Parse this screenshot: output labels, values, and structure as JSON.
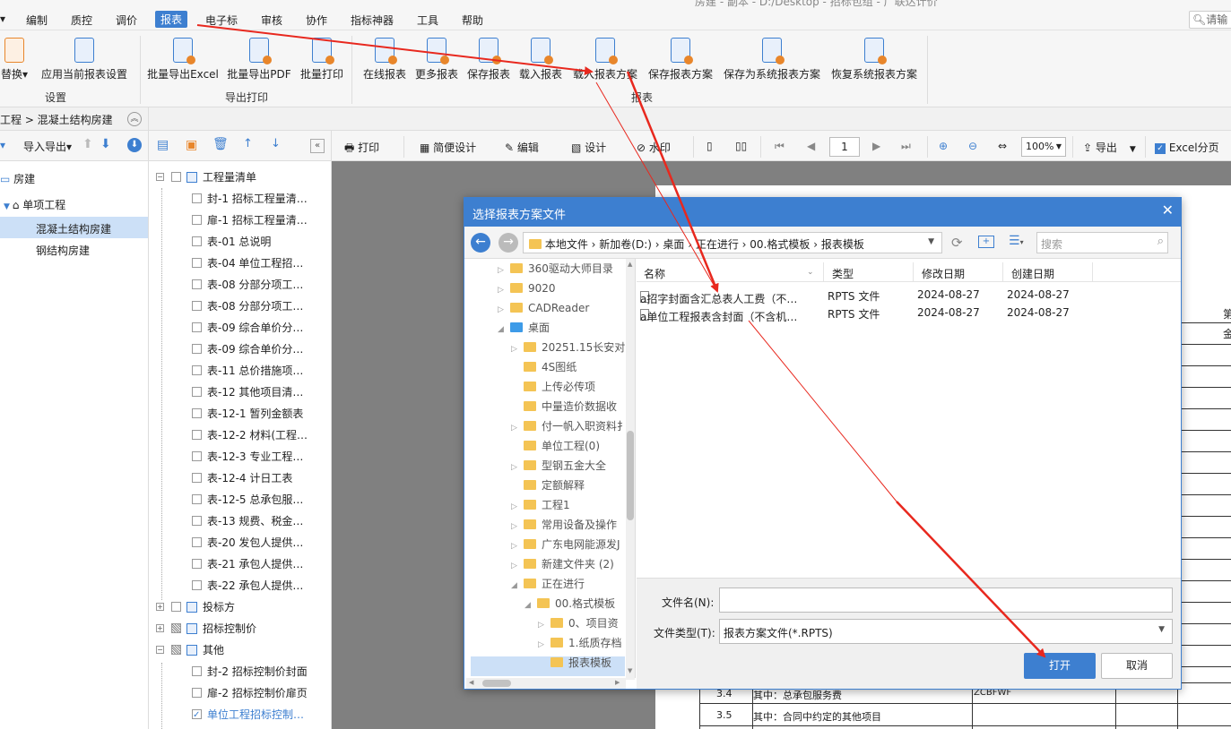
{
  "titlebar": {
    "text": "房建 - 副本 - D:/Desktop - 招标包组 - 广联达计价"
  },
  "menu": {
    "items": [
      "编制",
      "质控",
      "调价",
      "报表",
      "电子标",
      "审核",
      "协作",
      "指标神器",
      "工具",
      "帮助"
    ],
    "active": "报表",
    "search_placeholder": "请输"
  },
  "ribbon": {
    "settings": {
      "items": [
        "替换",
        "应用当前报表设置"
      ],
      "label": "设置"
    },
    "export_print": {
      "items": [
        "批量导出Excel",
        "批量导出PDF",
        "批量打印"
      ],
      "label": "导出打印"
    },
    "report": {
      "items": [
        "在线报表",
        "更多报表",
        "保存报表",
        "载入报表",
        "载入报表方案",
        "保存报表方案",
        "保存为系统报表方案",
        "恢复系统报表方案"
      ],
      "label": "报表"
    }
  },
  "breadcrumb": {
    "text": "工程 > 混凝土结构房建"
  },
  "left": {
    "toolbar": {
      "import_export": "导入导出"
    },
    "tree": [
      {
        "label": "房建",
        "level": 0
      },
      {
        "label": "单项工程",
        "level": 1
      },
      {
        "label": "混凝土结构房建",
        "level": 2,
        "selected": true
      },
      {
        "label": "钢结构房建",
        "level": 2
      }
    ]
  },
  "reports": {
    "groups": [
      {
        "label": "工程量清单",
        "expanded": true,
        "items": [
          "封-1 招标工程量清…",
          "扉-1 招标工程量清…",
          "表-01 总说明",
          "表-04 单位工程招…",
          "表-08 分部分项工…",
          "表-08 分部分项工…",
          "表-09 综合单价分…",
          "表-09 综合单价分…",
          "表-11 总价措施项…",
          "表-12 其他项目清…",
          "表-12-1 暂列金额表",
          "表-12-2 材料(工程…",
          "表-12-3 专业工程…",
          "表-12-4 计日工表",
          "表-12-5 总承包服…",
          "表-13 规费、税金…",
          "表-20 发包人提供…",
          "表-21 承包人提供…",
          "表-22 承包人提供…"
        ]
      },
      {
        "label": "投标方",
        "expanded": false,
        "items": []
      },
      {
        "label": "招标控制价",
        "expanded": false,
        "items": []
      },
      {
        "label": "其他",
        "expanded": true,
        "items": [
          "封-2 招标控制价封面",
          "扉-2 招标控制价扉页",
          "单位工程招标控制…"
        ]
      }
    ],
    "checked_item": "单位工程招标控制…"
  },
  "preview_toolbar": {
    "print": "打印",
    "simple_design": "简便设计",
    "edit": "编辑",
    "design": "设计",
    "watermark": "水印",
    "page": "1",
    "zoom": "100%",
    "export": "导出",
    "excel_paging": "Excel分页"
  },
  "preview": {
    "rows": [
      {
        "no": "3.4",
        "name": "其中：总承包服务费",
        "code": "ZCBFWF"
      },
      {
        "no": "3.5",
        "name": "其中：合同中约定的其他项目",
        "code": ""
      }
    ],
    "edge_text": [
      "第",
      "金"
    ]
  },
  "dialog": {
    "title": "选择报表方案文件",
    "path": [
      "本地文件",
      "新加卷(D:)",
      "桌面",
      "正在进行",
      "00.格式模板",
      "报表模板"
    ],
    "search_placeholder": "搜索",
    "folders": [
      {
        "label": "360驱动大师目录",
        "level": 1,
        "arrow": true
      },
      {
        "label": "9020",
        "level": 1,
        "arrow": true
      },
      {
        "label": "CADReader",
        "level": 1,
        "arrow": true
      },
      {
        "label": "桌面",
        "level": 1,
        "arrow": true,
        "open": true,
        "desktop": true
      },
      {
        "label": "20251.15长安对",
        "level": 2,
        "arrow": true
      },
      {
        "label": "4S图纸",
        "level": 2,
        "arrow": false
      },
      {
        "label": "上传必传项",
        "level": 2,
        "arrow": false
      },
      {
        "label": "中量造价数据收",
        "level": 2,
        "arrow": false
      },
      {
        "label": "付一帆入职资料扌",
        "level": 2,
        "arrow": true
      },
      {
        "label": "单位工程(0)",
        "level": 2,
        "arrow": false
      },
      {
        "label": "型钢五金大全",
        "level": 2,
        "arrow": true
      },
      {
        "label": "定额解释",
        "level": 2,
        "arrow": false
      },
      {
        "label": "工程1",
        "level": 2,
        "arrow": true
      },
      {
        "label": "常用设备及操作",
        "level": 2,
        "arrow": true
      },
      {
        "label": "广东电网能源发J",
        "level": 2,
        "arrow": true
      },
      {
        "label": "新建文件夹 (2)",
        "level": 2,
        "arrow": true
      },
      {
        "label": "正在进行",
        "level": 2,
        "arrow": true,
        "open": true
      },
      {
        "label": "00.格式模板",
        "level": 3,
        "arrow": true,
        "open": true
      },
      {
        "label": "0、项目资",
        "level": 4,
        "arrow": true
      },
      {
        "label": "1.纸质存档",
        "level": 4,
        "arrow": true
      },
      {
        "label": "报表模板",
        "level": 4,
        "arrow": false,
        "selected": true
      }
    ],
    "columns": [
      "名称",
      "类型",
      "修改日期",
      "创建日期"
    ],
    "files": [
      {
        "name": "a招字封面含汇总表人工费（不…",
        "type": "RPTS 文件",
        "modified": "2024-08-27",
        "created": "2024-08-27"
      },
      {
        "name": "a单位工程报表含封面（不含机…",
        "type": "RPTS 文件",
        "modified": "2024-08-27",
        "created": "2024-08-27"
      }
    ],
    "filename_label": "文件名(N):",
    "filename_value": "",
    "filetype_label": "文件类型(T):",
    "filetype_value": "报表方案文件(*.RPTS)",
    "open_button": "打开",
    "cancel_button": "取消"
  },
  "colors": {
    "accent": "#3d7fd0",
    "annotation": "#e8281e",
    "folder": "#f4c454"
  }
}
